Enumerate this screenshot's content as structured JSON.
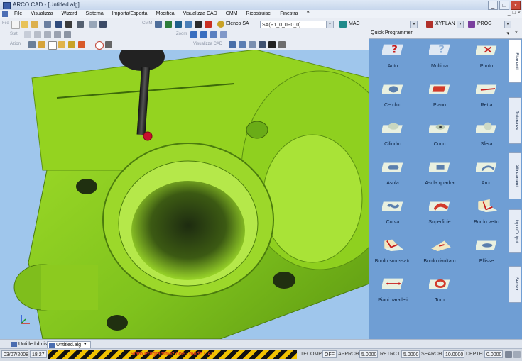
{
  "window": {
    "title": "ARCO CAD - [Untitled.alg]",
    "minimize": "_",
    "maximize": "□",
    "close": "×"
  },
  "menu": {
    "items": [
      "File",
      "Visualizza",
      "Wizard",
      "Sistema",
      "Importa/Esporta",
      "Modifica",
      "Visualizza CAD",
      "CMM",
      "Ricostruisci",
      "Finestra",
      "?"
    ],
    "mdi": [
      "_",
      "□",
      "×"
    ]
  },
  "toolbar1": {
    "file_label": "File",
    "cmm_label": "CMM",
    "elenco_label": "Elenco SA",
    "sa_value": "SA(P1_0_0P0_0)",
    "mac_label": "MAC",
    "xyplan_label": "XYPLAN",
    "prog_label": "PROG"
  },
  "toolbar2": {
    "stati_label": "Stati",
    "zoom_label": "Zoom"
  },
  "toolbar3": {
    "azioni_label": "Azioni",
    "viscad_label": "Visualizza CAD"
  },
  "panel": {
    "title": "Quick Programmer",
    "pin": "▾",
    "close": "×",
    "tiles": [
      {
        "label": "Auto",
        "icon": "question-icon"
      },
      {
        "label": "Multipla",
        "icon": "question-multi-icon"
      },
      {
        "label": "Punto",
        "icon": "point-icon"
      },
      {
        "label": "Cerchio",
        "icon": "circle-icon"
      },
      {
        "label": "Piano",
        "icon": "plane-icon"
      },
      {
        "label": "Retta",
        "icon": "line-icon"
      },
      {
        "label": "Cilindro",
        "icon": "cylinder-icon"
      },
      {
        "label": "Cono",
        "icon": "cone-icon"
      },
      {
        "label": "Sfera",
        "icon": "sphere-icon"
      },
      {
        "label": "Asola",
        "icon": "slot-icon"
      },
      {
        "label": "Asola quadra",
        "icon": "square-slot-icon"
      },
      {
        "label": "Arco",
        "icon": "arc-icon"
      },
      {
        "label": "Curva",
        "icon": "curve-icon"
      },
      {
        "label": "Superficie",
        "icon": "surface-icon"
      },
      {
        "label": "Bordo vetto",
        "icon": "edge-icon"
      },
      {
        "label": "Bordo smussato",
        "icon": "chamfer-edge-icon"
      },
      {
        "label": "Bordo rivoltato",
        "icon": "folded-edge-icon"
      },
      {
        "label": "Ellisse",
        "icon": "ellipse-icon"
      },
      {
        "label": "Piani paralleli",
        "icon": "parallel-planes-icon"
      },
      {
        "label": "Toro",
        "icon": "torus-icon"
      }
    ],
    "vtabs": [
      "Elementi",
      "Tolleranze",
      "Allineamenti",
      "Input/Output",
      "Sensori"
    ]
  },
  "docs": [
    "Untitled.dmis",
    "Untitled.alg"
  ],
  "status": {
    "date": "03/07/2008",
    "time": "18:27",
    "stripe_text": "Stato Programmazione - modo CAD",
    "tecomp_label": "TECOMP",
    "tecomp_value": "OFF",
    "apprch_label": "APPRCH",
    "apprch_value": "5.0000",
    "retrct_label": "RETRCT",
    "retrct_value": "5.0000",
    "search_label": "SEARCH",
    "search_value": "10.0000",
    "depth_label": "DEPTH",
    "depth_value": "0.0000"
  },
  "colors": {
    "part": "#8ed41f",
    "viewport_bg": "#9fc6ec",
    "panel_bg": "#6f9ed4",
    "probe_tip": "#c8102e"
  }
}
